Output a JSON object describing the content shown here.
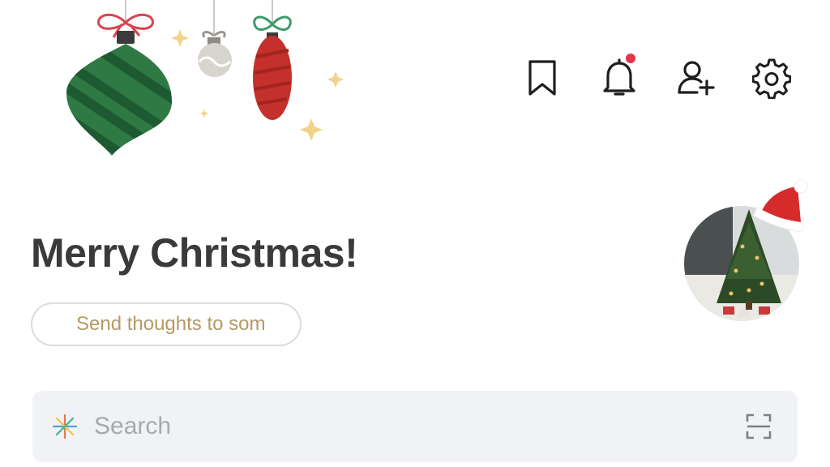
{
  "header": {
    "icons": [
      "bookmark-icon",
      "bell-icon",
      "add-friend-icon",
      "gear-icon"
    ],
    "notification_badge": true
  },
  "greeting": {
    "title": "Merry Christmas!"
  },
  "thought_input": {
    "placeholder": "Send thoughts to som"
  },
  "search": {
    "placeholder": "Search"
  },
  "colors": {
    "accent_red": "#e0374b",
    "ornament_green": "#2f7a44",
    "ornament_red": "#c4302b",
    "placeholder_gold": "#b39a62",
    "search_bg": "#f1f2f6"
  }
}
